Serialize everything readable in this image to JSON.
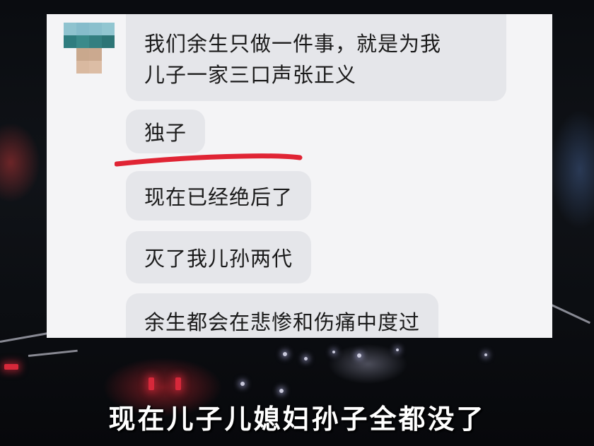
{
  "chat": {
    "messages": [
      {
        "text": "我们余生只做一件事，就是为我\n儿子一家三口声张正义"
      },
      {
        "text": "独子",
        "marked": true
      },
      {
        "text": "现在已经绝后了"
      },
      {
        "text": "灭了我儿孙两代"
      },
      {
        "text": "余生都会在悲惨和伤痛中度过"
      }
    ],
    "avatar_icon": "pixelated-avatar-icon",
    "mark_color": "#e02434"
  },
  "caption": {
    "text": "现在儿子儿媳妇孙子全都没了"
  },
  "colors": {
    "panel": "#f4f4f6",
    "bubble": "#e5e6ea",
    "text": "#1b1b1b",
    "background": "#050608"
  }
}
